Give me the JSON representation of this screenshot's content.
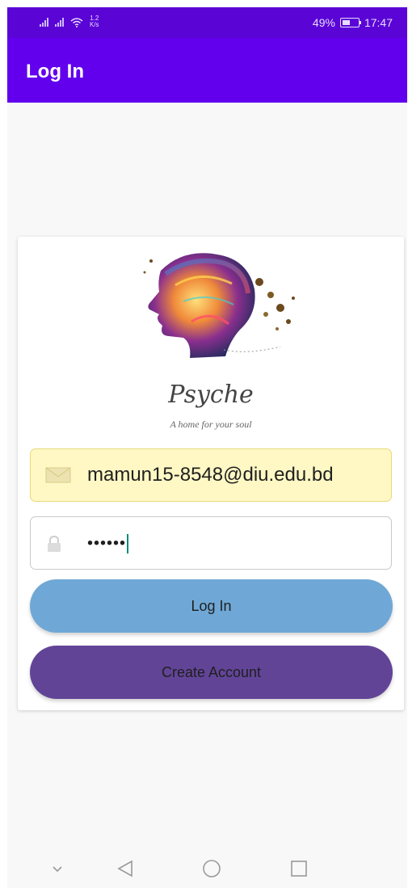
{
  "status_bar": {
    "speed_top": "1.2",
    "speed_unit": "K/s",
    "battery_percent": "49%",
    "time": "17:47"
  },
  "app_bar": {
    "title": "Log In"
  },
  "brand": {
    "name": "Psyche",
    "tagline": "A home for your soul"
  },
  "form": {
    "email": {
      "value": "mamun15-8548@diu.edu.bd",
      "icon": "envelope-icon"
    },
    "password": {
      "masked_value": "••••••",
      "icon": "lock-icon"
    }
  },
  "buttons": {
    "login_label": "Log In",
    "create_label": "Create Account"
  },
  "colors": {
    "status_bar": "#5a04d6",
    "app_bar": "#6200ee",
    "email_field_bg": "#fff8c4",
    "login_button": "#6fa8d6",
    "create_button": "#624497"
  },
  "nav_bar": {
    "icons": [
      "chevron-down-icon",
      "back-icon",
      "home-icon",
      "recents-icon"
    ]
  }
}
